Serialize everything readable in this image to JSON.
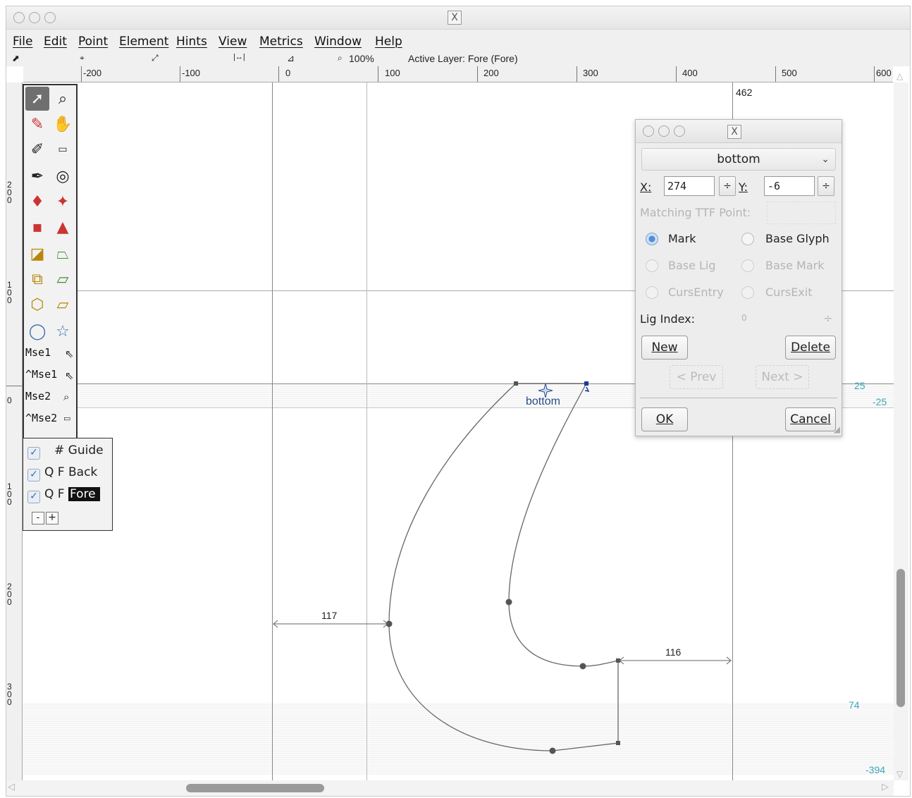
{
  "window": {
    "title_icon": "X"
  },
  "menu": [
    "File",
    "Edit",
    "Point",
    "Element",
    "Hints",
    "View",
    "Metrics",
    "Window",
    "Help"
  ],
  "infobar": {
    "zoom": "100%",
    "active_layer": "Active Layer: Fore (Fore)"
  },
  "ruler": {
    "h_labels": [
      "-200",
      "-100",
      "0",
      "100",
      "200",
      "300",
      "400",
      "500",
      "600"
    ],
    "v_labels": [
      "200",
      "100",
      "0",
      "100",
      "200",
      "300"
    ]
  },
  "toolbox": {
    "mouse_labels": [
      "Mse1",
      "^Mse1",
      "Mse2",
      "^Mse2"
    ]
  },
  "layers": {
    "guide": "# Guide",
    "back_prefix": "Q F",
    "back": "Back",
    "fore_prefix": "Q F",
    "fore": "Fore",
    "minus": "-",
    "plus": "+"
  },
  "canvas": {
    "top_value": "462",
    "anchor_label": "bottom",
    "dim_left": "117",
    "dim_right": "116",
    "right_labels": {
      "a": "25",
      "b": "-25",
      "c": "74",
      "d": "-394"
    }
  },
  "dialog": {
    "title_icon": "X",
    "anchor_class": "bottom",
    "x_label": "X:",
    "x_value": "274",
    "y_label": "Y:",
    "y_value": "-6",
    "matching_label": "Matching TTF Point:",
    "radios": {
      "mark": "Mark",
      "base_glyph": "Base Glyph",
      "base_lig": "Base Lig",
      "base_mark": "Base Mark",
      "curs_entry": "CursEntry",
      "curs_exit": "CursExit"
    },
    "lig_index_label": "Lig Index:",
    "lig_index_value": "0",
    "new": "New",
    "delete": "Delete",
    "prev": "< Prev",
    "next": "Next >",
    "ok": "OK",
    "cancel": "Cancel"
  }
}
